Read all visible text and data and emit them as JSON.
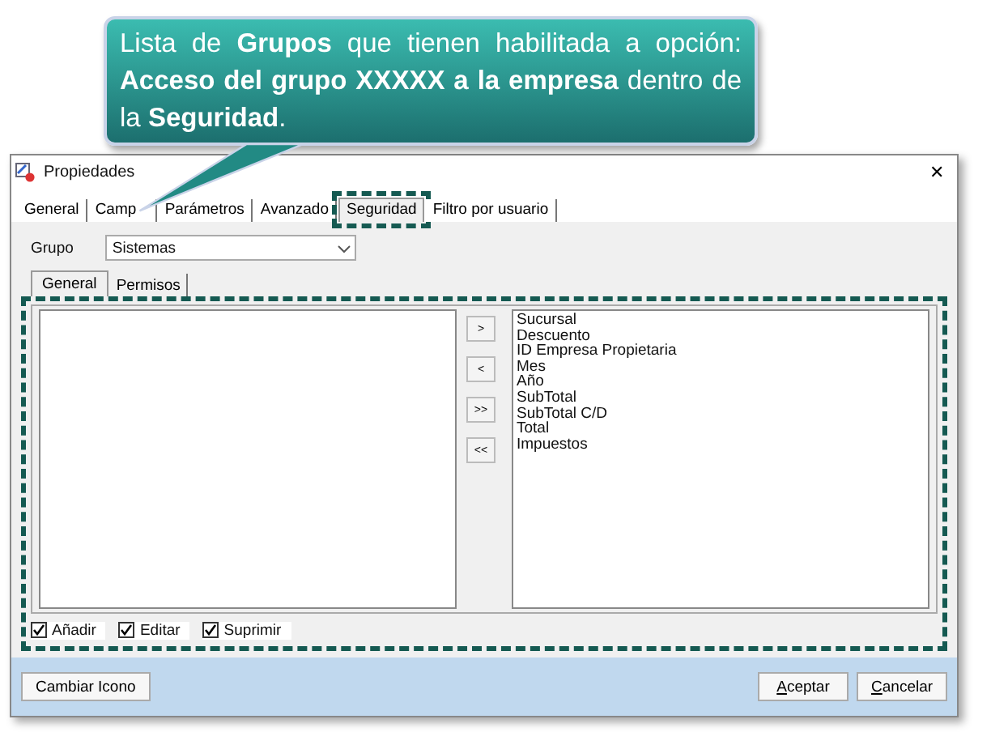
{
  "callout": {
    "text": "Lista de **Grupos** que tienen habilitada a opción: **Acceso del grupo XXXXX a la empresa** dentro de la **Seguridad**."
  },
  "window": {
    "title": "Propiedades",
    "close": "✕"
  },
  "tabs": [
    {
      "label": "General",
      "selected": false,
      "highlighted": false
    },
    {
      "label": "Camp",
      "selected": false,
      "highlighted": false
    },
    {
      "label": "Parámetros",
      "selected": false,
      "highlighted": false
    },
    {
      "label": "Avanzado",
      "selected": false,
      "highlighted": false
    },
    {
      "label": "Seguridad",
      "selected": true,
      "highlighted": true
    },
    {
      "label": "Filtro por usuario",
      "selected": false,
      "highlighted": false
    }
  ],
  "grupo": {
    "label": "Grupo",
    "value": "Sistemas"
  },
  "subtabs": [
    {
      "label": "General",
      "selected": true
    },
    {
      "label": "Permisos",
      "selected": false
    }
  ],
  "move_buttons": [
    ">",
    "<",
    ">>",
    "<<"
  ],
  "right_list": [
    "Sucursal",
    "Descuento",
    "ID Empresa Propietaria",
    "Mes",
    "Año",
    "SubTotal",
    "SubTotal C/D",
    "Total",
    "Impuestos"
  ],
  "checkboxes": [
    {
      "label": "Añadir",
      "checked": true
    },
    {
      "label": "Editar",
      "checked": true
    },
    {
      "label": "Suprimir",
      "checked": true
    }
  ],
  "footer": {
    "left_button": "Cambiar Icono",
    "buttons": [
      {
        "label": "Aceptar"
      },
      {
        "label": "Cancelar"
      }
    ]
  }
}
